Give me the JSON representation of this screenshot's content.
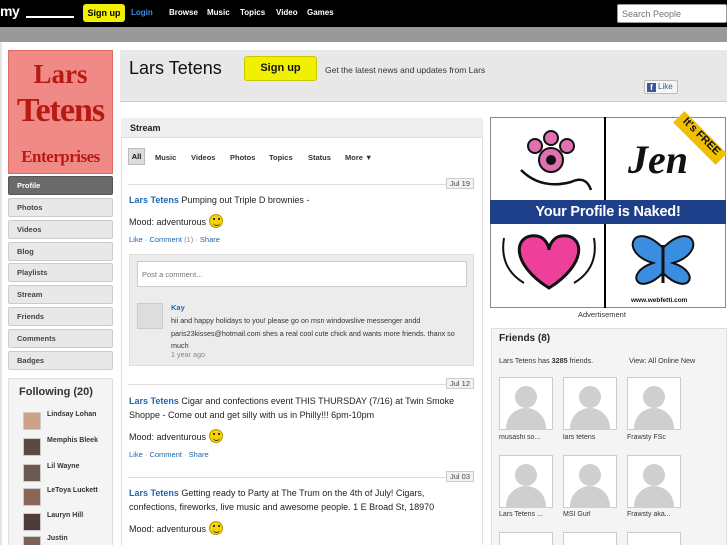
{
  "topbar": {
    "logo": "my",
    "signup": "Sign up",
    "login": "Login",
    "nav": [
      "Browse",
      "Music",
      "Topics",
      "Video",
      "Games"
    ],
    "search_placeholder": "Search People"
  },
  "profile": {
    "picture_text": [
      "Lars",
      "Tetens",
      "Enterprises"
    ],
    "name": "Lars Tetens",
    "signup_button": "Sign up",
    "tagline": "Get the latest news and updates from Lars",
    "fb_like": "Like"
  },
  "sidebar": {
    "items": [
      {
        "label": "Profile",
        "active": true
      },
      {
        "label": "Photos"
      },
      {
        "label": "Videos"
      },
      {
        "label": "Blog"
      },
      {
        "label": "Playlists"
      },
      {
        "label": "Stream"
      },
      {
        "label": "Friends"
      },
      {
        "label": "Comments"
      },
      {
        "label": "Badges"
      }
    ]
  },
  "following": {
    "title": "Following (20)",
    "people": [
      "Lindsay Lohan",
      "Memphis Bleek",
      "Lil Wayne",
      "LeToya Luckett",
      "Lauryn Hill",
      "Justin"
    ]
  },
  "stream": {
    "title": "Stream",
    "filters": [
      "All",
      "Music",
      "Videos",
      "Photos",
      "Topics",
      "Status",
      "More ▼"
    ],
    "posts": [
      {
        "date": "Jul 19",
        "author": "Lars Tetens",
        "text": "Pumping out Triple D brownies -",
        "mood": "Mood: adventurous",
        "like": "Like",
        "comment": "Comment",
        "comment_count": "(1)",
        "share": "Share"
      },
      {
        "date": "Jul 12",
        "author": "Lars Tetens",
        "text": "Cigar and confections event THIS THURSDAY (7/16) at Twin Smoke Shoppe - Come out and get silly with us in Philly!!! 6pm-10pm",
        "mood": "Mood: adventurous",
        "like": "Like",
        "comment": "Comment",
        "share": "Share"
      },
      {
        "date": "Jul 03",
        "author": "Lars Tetens",
        "text": "Getting ready to Party at The Trum on the 4th of July! Cigars, confections, fireworks, live music and awesome people. 1 E Broad St, 18970",
        "mood": "Mood: adventurous"
      }
    ],
    "comment_placeholder": "Post a comment...",
    "comment": {
      "author": "Kay",
      "text": "hii and happy holidays to you! please go on msn windowslive messenger andd paris23kisses@hotmail.com shes a real cool cute chick and wants more friends. thanx so much",
      "time": "1 year ago"
    }
  },
  "ad": {
    "headline": "Your Profile is Naked!",
    "name": "Jen",
    "badge": "It's FREE",
    "url": "www.webfetti.com",
    "label": "Advertisement"
  },
  "friends": {
    "title": "Friends (8)",
    "count_text_prefix": "Lars Tetens has ",
    "count": "3285",
    "count_text_suffix": " friends.",
    "view_label": "View:",
    "view_options": [
      "All",
      "Online",
      "New"
    ],
    "people": [
      "musashi so...",
      "lars tetens",
      "Frawsty FSc",
      "Lars Tetens ...",
      "MSI Gurl",
      "Frawsty aka..."
    ]
  },
  "colors": {
    "accent_yellow": "#f0f000",
    "link_blue": "#1f67b2",
    "profile_pink": "#f08a86",
    "ad_blue": "#1e3f8a"
  }
}
